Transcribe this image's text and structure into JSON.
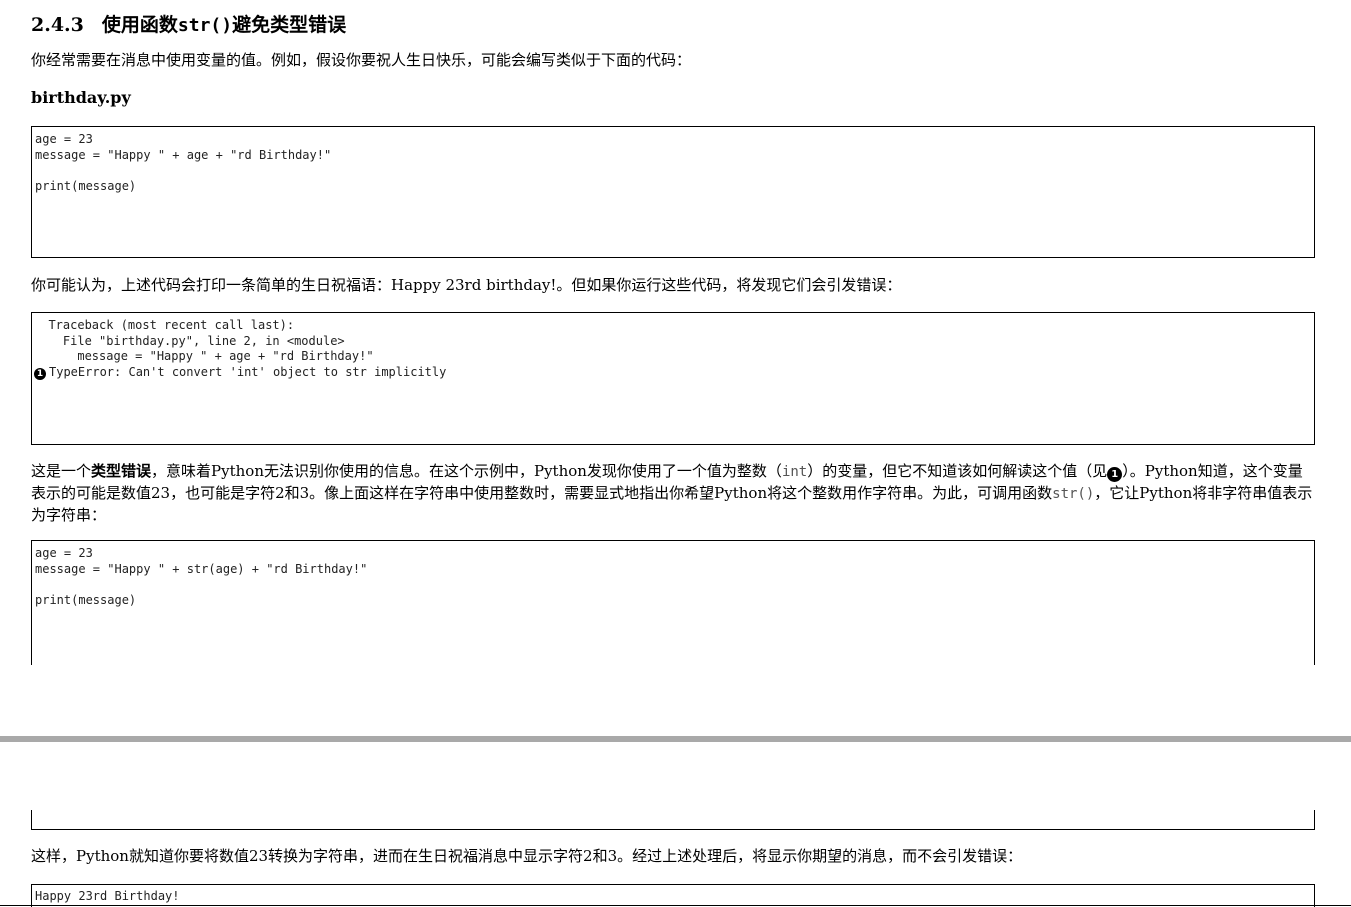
{
  "section": {
    "number": "2.4.3",
    "title_before": "使用函数",
    "title_code": "str()",
    "title_after": "避免类型错误"
  },
  "intro": "你经常需要在消息中使用变量的值。例如，假设你要祝人生日快乐，可能会编写类似于下面的代码：",
  "filename": "birthday.py",
  "code1": {
    "lines": [
      "age = 23",
      "message = \"Happy \" + age + \"rd Birthday!\"",
      "",
      "print(message)"
    ]
  },
  "para2": "你可能认为，上述代码会打印一条简单的生日祝福语：Happy 23rd birthday!。但如果你运行这些代码，将发现它们会引发错误：",
  "traceback": {
    "line1": "  Traceback (most recent call last):",
    "line2": "    File \"birthday.py\", line 2, in <module>",
    "line3": "      message = \"Happy \" + age + \"rd Birthday!\"",
    "marker": "1",
    "line4": "TypeError: Can't convert 'int' object to str implicitly"
  },
  "para3": {
    "part1": "这是一个",
    "bold": "类型错误",
    "part2": "，意味着Python无法识别你使用的信息。在这个示例中，Python发现你使用了一个值为整数（",
    "code_int": "int",
    "part3": "）的变量，但它不知道该如何解读这个值（见",
    "marker": "1",
    "part4": "）。Python知道，这个变量表示的可能是数值23，也可能是字符2和3。像上面这样在字符串中使用整数时，需要显式地指出你希望Python将这个整数用作字符串。为此，可调用函数",
    "code_str": "str()",
    "part5": "，它让Python将非字符串值表示为字符串："
  },
  "code2": {
    "lines": [
      "age = 23",
      "message = \"Happy \" + str(age) + \"rd Birthday!\"",
      "",
      "print(message)"
    ]
  },
  "para4": "这样，Python就知道你要将数值23转换为字符串，进而在生日祝福消息中显示字符2和3。经过上述处理后，将显示你期望的消息，而不会引发错误：",
  "output": {
    "line1": "Happy 23rd Birthday!"
  }
}
